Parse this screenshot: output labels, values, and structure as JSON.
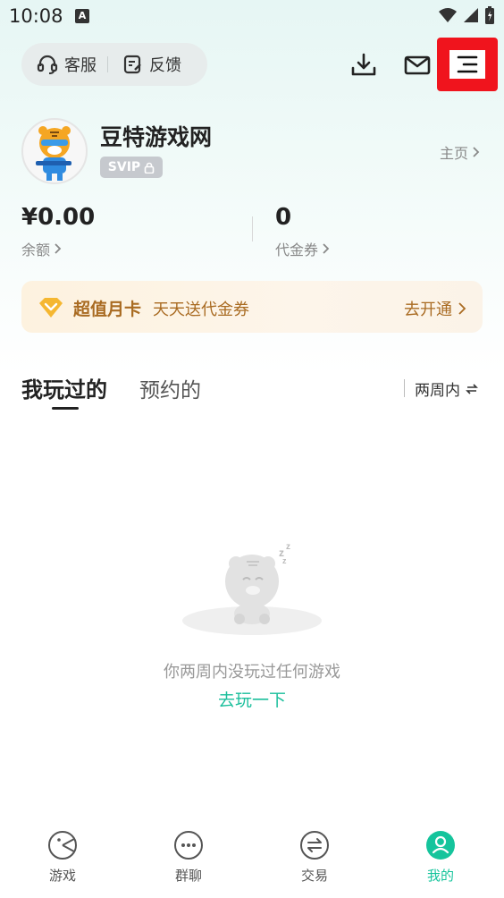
{
  "status_bar": {
    "time": "10:08",
    "notification_letter": "A"
  },
  "top_bar": {
    "service_label": "客服",
    "feedback_label": "反馈",
    "icons": [
      "download-icon",
      "mail-icon",
      "menu-icon"
    ],
    "highlight_color": "#f0141d"
  },
  "profile": {
    "username": "豆特游戏网",
    "badge": "SVIP",
    "home_link": "主页"
  },
  "wallet": {
    "balance_value": "¥0.00",
    "balance_label": "余额",
    "coupon_value": "0",
    "coupon_label": "代金券"
  },
  "monthly_card": {
    "title": "超值月卡",
    "subtitle": "天天送代金券",
    "action": "去开通",
    "accent_color": "#a96b22"
  },
  "tabs": {
    "played": "我玩过的",
    "reserved": "预约的",
    "filter": "两周内"
  },
  "empty_state": {
    "message": "你两周内没玩过任何游戏",
    "action": "去玩一下",
    "action_color": "#1bbf9c"
  },
  "bottom_nav": {
    "items": [
      {
        "label": "游戏",
        "icon": "game-icon"
      },
      {
        "label": "群聊",
        "icon": "chat-icon"
      },
      {
        "label": "交易",
        "icon": "trade-icon"
      },
      {
        "label": "我的",
        "icon": "profile-icon"
      }
    ],
    "active_index": 3,
    "active_color": "#15c49c"
  }
}
